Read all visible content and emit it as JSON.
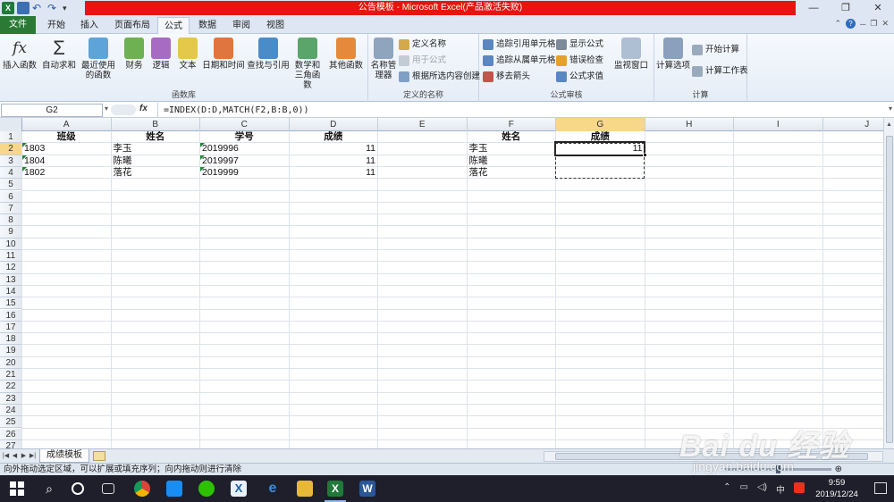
{
  "window": {
    "title": "公告模板 - Microsoft Excel(产品激活失败)",
    "controls": [
      "—",
      "❐",
      "✕"
    ]
  },
  "ribbon_tabs": [
    "文件",
    "开始",
    "插入",
    "页面布局",
    "公式",
    "数据",
    "审阅",
    "视图"
  ],
  "active_tab": "公式",
  "ribbon": {
    "function_library": {
      "group_label": "函数库",
      "insert_function": "插入函数",
      "autosum": "自动求和",
      "recent": "最近使用的函数",
      "financial": "财务",
      "logical": "逻辑",
      "text": "文本",
      "datetime": "日期和时间",
      "lookup": "查找与引用",
      "math": "数学和三角函数",
      "more": "其他函数"
    },
    "defined_names": {
      "group_label": "定义的名称",
      "name_manager": "名称管理器",
      "define_name": "定义名称",
      "use_in_formula": "用于公式",
      "create_from_selection": "根据所选内容创建"
    },
    "formula_auditing": {
      "group_label": "公式审核",
      "trace_precedents": "追踪引用单元格",
      "trace_dependents": "追踪从属单元格",
      "remove_arrows": "移去箭头",
      "show_formulas": "显示公式",
      "error_checking": "错误检查",
      "evaluate_formula": "公式求值",
      "watch_window": "监视窗口"
    },
    "calculation": {
      "group_label": "计算",
      "calc_options": "计算选项",
      "calc_now": "开始计算",
      "calc_sheet": "计算工作表"
    }
  },
  "formula_bar": {
    "name_box": "G2",
    "fx": "fx",
    "formula": "=INDEX(D:D,MATCH(F2,B:B,0))"
  },
  "columns": [
    "A",
    "B",
    "C",
    "D",
    "E",
    "F",
    "G",
    "H",
    "I",
    "J"
  ],
  "selected_column": "G",
  "rows": [
    "1",
    "2",
    "3",
    "4",
    "5",
    "6",
    "7",
    "8",
    "9",
    "10",
    "11",
    "12",
    "13",
    "14",
    "15",
    "16",
    "17",
    "18",
    "19",
    "20",
    "21",
    "22",
    "23",
    "24",
    "25",
    "26",
    "27"
  ],
  "selected_row": "2",
  "cells": {
    "A1": "班级",
    "B1": "姓名",
    "C1": "学号",
    "D1": "成绩",
    "F1": "姓名",
    "G1": "成绩",
    "A2": "1803",
    "B2": "李玉",
    "C2": "2019996",
    "D2": "11",
    "F2": "李玉",
    "G2": "11",
    "A3": "1804",
    "B3": "陈曦",
    "C3": "2019997",
    "D3": "11",
    "F3": "陈曦",
    "A4": "1802",
    "B4": "落花",
    "C4": "2019999",
    "D4": "11",
    "F4": "落花"
  },
  "sheet_tabs": [
    "成绩模板"
  ],
  "status": {
    "message": "向外拖动选定区域，可以扩展或填充序列；向内拖动则进行清除"
  },
  "taskbar": {
    "time": "9:59",
    "date": "2019/12/24",
    "ime": "中"
  },
  "watermark": {
    "brand": "Bai du 经验",
    "url": "jingyan.baidu.com"
  },
  "colors": {
    "title_bar_red": "#e8140f",
    "file_tab_green": "#2a7a35",
    "selection_header": "#f7d78a",
    "taskbar": "#1e1f2b"
  }
}
